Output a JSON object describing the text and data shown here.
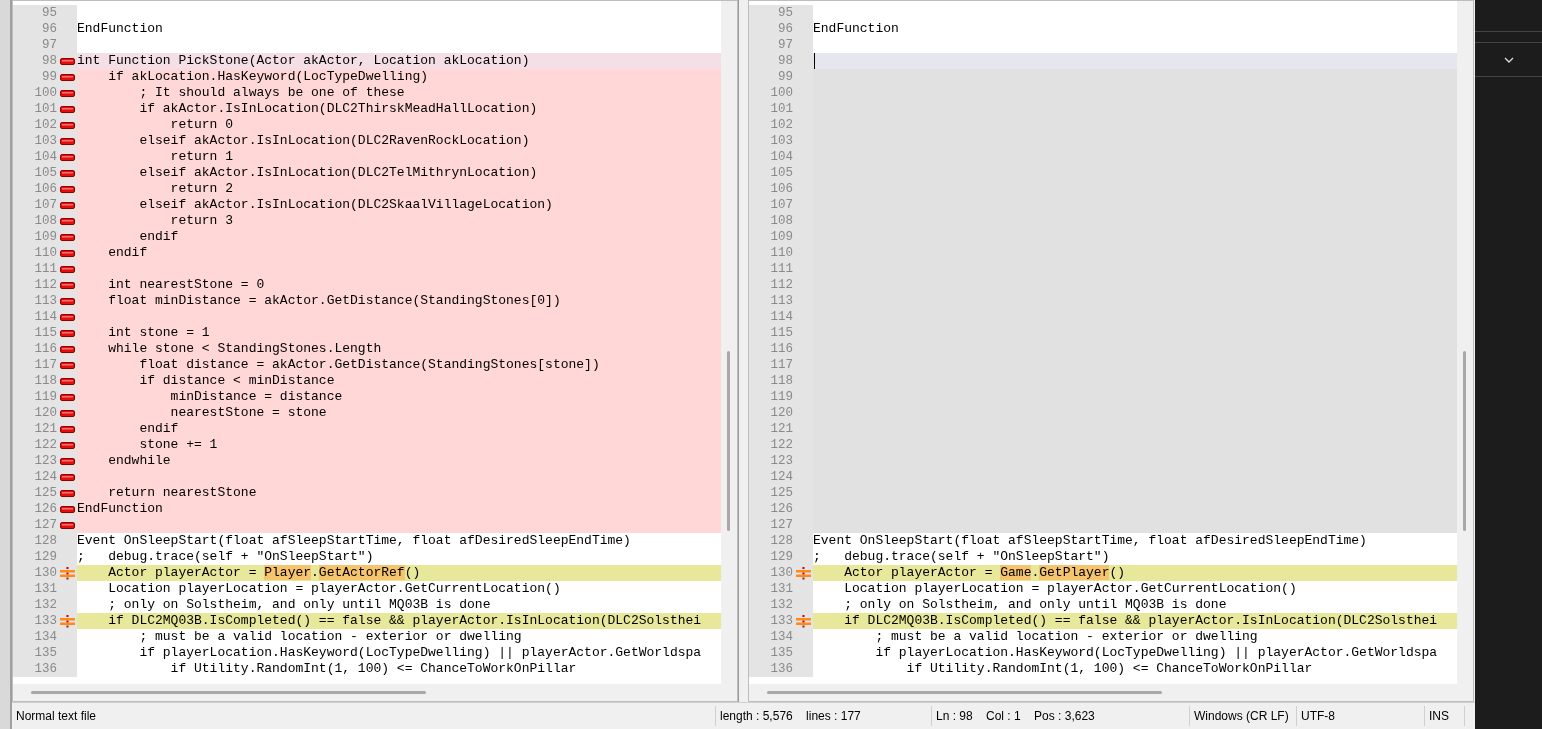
{
  "panes": [
    {
      "caret": false,
      "lines": [
        {
          "n": "95",
          "kind": "normal"
        },
        {
          "n": "96",
          "kind": "normal",
          "text": "EndFunction"
        },
        {
          "n": "97",
          "kind": "normal"
        },
        {
          "n": "98",
          "kind": "removed",
          "current": true,
          "text": "int Function PickStone(Actor akActor, Location akLocation)"
        },
        {
          "n": "99",
          "kind": "removed",
          "text": "    if akLocation.HasKeyword(LocTypeDwelling)"
        },
        {
          "n": "100",
          "kind": "removed",
          "text": "        ; It should always be one of these"
        },
        {
          "n": "101",
          "kind": "removed",
          "text": "        if akActor.IsInLocation(DLC2ThirskMeadHallLocation)"
        },
        {
          "n": "102",
          "kind": "removed",
          "text": "            return 0"
        },
        {
          "n": "103",
          "kind": "removed",
          "text": "        elseif akActor.IsInLocation(DLC2RavenRockLocation)"
        },
        {
          "n": "104",
          "kind": "removed",
          "text": "            return 1"
        },
        {
          "n": "105",
          "kind": "removed",
          "text": "        elseif akActor.IsInLocation(DLC2TelMithrynLocation)"
        },
        {
          "n": "106",
          "kind": "removed",
          "text": "            return 2"
        },
        {
          "n": "107",
          "kind": "removed",
          "text": "        elseif akActor.IsInLocation(DLC2SkaalVillageLocation)"
        },
        {
          "n": "108",
          "kind": "removed",
          "text": "            return 3"
        },
        {
          "n": "109",
          "kind": "removed",
          "text": "        endif"
        },
        {
          "n": "110",
          "kind": "removed",
          "text": "    endif"
        },
        {
          "n": "111",
          "kind": "removed"
        },
        {
          "n": "112",
          "kind": "removed",
          "text": "    int nearestStone = 0"
        },
        {
          "n": "113",
          "kind": "removed",
          "text": "    float minDistance = akActor.GetDistance(StandingStones[0])"
        },
        {
          "n": "114",
          "kind": "removed"
        },
        {
          "n": "115",
          "kind": "removed",
          "text": "    int stone = 1"
        },
        {
          "n": "116",
          "kind": "removed",
          "text": "    while stone < StandingStones.Length"
        },
        {
          "n": "117",
          "kind": "removed",
          "text": "        float distance = akActor.GetDistance(StandingStones[stone])"
        },
        {
          "n": "118",
          "kind": "removed",
          "text": "        if distance < minDistance"
        },
        {
          "n": "119",
          "kind": "removed",
          "text": "            minDistance = distance"
        },
        {
          "n": "120",
          "kind": "removed",
          "text": "            nearestStone = stone"
        },
        {
          "n": "121",
          "kind": "removed",
          "text": "        endif"
        },
        {
          "n": "122",
          "kind": "removed",
          "text": "        stone += 1"
        },
        {
          "n": "123",
          "kind": "removed",
          "text": "    endwhile"
        },
        {
          "n": "124",
          "kind": "removed"
        },
        {
          "n": "125",
          "kind": "removed",
          "text": "    return nearestStone"
        },
        {
          "n": "126",
          "kind": "removed",
          "text": "EndFunction"
        },
        {
          "n": "127",
          "kind": "removed"
        },
        {
          "n": "128",
          "kind": "normal",
          "text": "Event OnSleepStart(float afSleepStartTime, float afDesiredSleepEndTime)"
        },
        {
          "n": "129",
          "kind": "normal",
          "text": ";   debug.trace(self + \"OnSleepStart\")"
        },
        {
          "n": "130",
          "kind": "changed",
          "segments": [
            {
              "text": "    Actor playerActor = ",
              "changed": false
            },
            {
              "text": "Player",
              "changed": true
            },
            {
              "text": ".",
              "changed": false
            },
            {
              "text": "GetActorRef",
              "changed": true
            },
            {
              "text": "()",
              "changed": false
            }
          ]
        },
        {
          "n": "131",
          "kind": "normal",
          "text": "    Location playerLocation = playerActor.GetCurrentLocation()"
        },
        {
          "n": "132",
          "kind": "normal",
          "text": "    ; only on Solstheim, and only until MQ03B is done"
        },
        {
          "n": "133",
          "kind": "changed",
          "segments": [
            {
              "text": "    if DLC2MQ03B.IsCompleted() == false && playerActor.IsInLocation(DLC2Solsthei",
              "changed": false
            }
          ]
        },
        {
          "n": "134",
          "kind": "normal",
          "text": "        ; must be a valid location - exterior or dwelling"
        },
        {
          "n": "135",
          "kind": "normal",
          "text": "        if playerLocation.HasKeyword(LocTypeDwelling) || playerActor.GetWorldspa"
        },
        {
          "n": "136",
          "kind": "normal",
          "text": "            if Utility.RandomInt(1, 100) <= ChanceToWorkOnPillar"
        }
      ]
    },
    {
      "caret": true,
      "lines": [
        {
          "n": "95",
          "kind": "normal"
        },
        {
          "n": "96",
          "kind": "normal",
          "text": "EndFunction"
        },
        {
          "n": "97",
          "kind": "normal"
        },
        {
          "n": "98",
          "kind": "placeholder",
          "current": true
        },
        {
          "n": "99",
          "kind": "placeholder"
        },
        {
          "n": "100",
          "kind": "placeholder"
        },
        {
          "n": "101",
          "kind": "placeholder"
        },
        {
          "n": "102",
          "kind": "placeholder"
        },
        {
          "n": "103",
          "kind": "placeholder"
        },
        {
          "n": "104",
          "kind": "placeholder"
        },
        {
          "n": "105",
          "kind": "placeholder"
        },
        {
          "n": "106",
          "kind": "placeholder"
        },
        {
          "n": "107",
          "kind": "placeholder"
        },
        {
          "n": "108",
          "kind": "placeholder"
        },
        {
          "n": "109",
          "kind": "placeholder"
        },
        {
          "n": "110",
          "kind": "placeholder"
        },
        {
          "n": "111",
          "kind": "placeholder"
        },
        {
          "n": "112",
          "kind": "placeholder"
        },
        {
          "n": "113",
          "kind": "placeholder"
        },
        {
          "n": "114",
          "kind": "placeholder"
        },
        {
          "n": "115",
          "kind": "placeholder"
        },
        {
          "n": "116",
          "kind": "placeholder"
        },
        {
          "n": "117",
          "kind": "placeholder"
        },
        {
          "n": "118",
          "kind": "placeholder"
        },
        {
          "n": "119",
          "kind": "placeholder"
        },
        {
          "n": "120",
          "kind": "placeholder"
        },
        {
          "n": "121",
          "kind": "placeholder"
        },
        {
          "n": "122",
          "kind": "placeholder"
        },
        {
          "n": "123",
          "kind": "placeholder"
        },
        {
          "n": "124",
          "kind": "placeholder"
        },
        {
          "n": "125",
          "kind": "placeholder"
        },
        {
          "n": "126",
          "kind": "placeholder"
        },
        {
          "n": "127",
          "kind": "placeholder"
        },
        {
          "n": "128",
          "kind": "normal",
          "text": "Event OnSleepStart(float afSleepStartTime, float afDesiredSleepEndTime)"
        },
        {
          "n": "129",
          "kind": "normal",
          "text": ";   debug.trace(self + \"OnSleepStart\")"
        },
        {
          "n": "130",
          "kind": "changed",
          "segments": [
            {
              "text": "    Actor playerActor = ",
              "changed": false
            },
            {
              "text": "Game",
              "changed": true
            },
            {
              "text": ".",
              "changed": false
            },
            {
              "text": "GetPlayer",
              "changed": true
            },
            {
              "text": "()",
              "changed": false
            }
          ]
        },
        {
          "n": "131",
          "kind": "normal",
          "text": "    Location playerLocation = playerActor.GetCurrentLocation()"
        },
        {
          "n": "132",
          "kind": "normal",
          "text": "    ; only on Solstheim, and only until MQ03B is done"
        },
        {
          "n": "133",
          "kind": "changed",
          "segments": [
            {
              "text": "    if DLC2MQ03B.IsCompleted() == false && playerActor.IsInLocation(DLC2Solsthei",
              "changed": false
            }
          ]
        },
        {
          "n": "134",
          "kind": "normal",
          "text": "        ; must be a valid location - exterior or dwelling"
        },
        {
          "n": "135",
          "kind": "normal",
          "text": "        if playerLocation.HasKeyword(LocTypeDwelling) || playerActor.GetWorldspa"
        },
        {
          "n": "136",
          "kind": "normal",
          "text": "            if Utility.RandomInt(1, 100) <= ChanceToWorkOnPillar"
        }
      ]
    }
  ],
  "status_bar": [
    "Normal text file",
    "length : 5,576    lines : 177",
    "Ln : 98    Col : 1    Pos : 3,623",
    "Windows (CR LF)",
    "UTF-8",
    "INS"
  ]
}
